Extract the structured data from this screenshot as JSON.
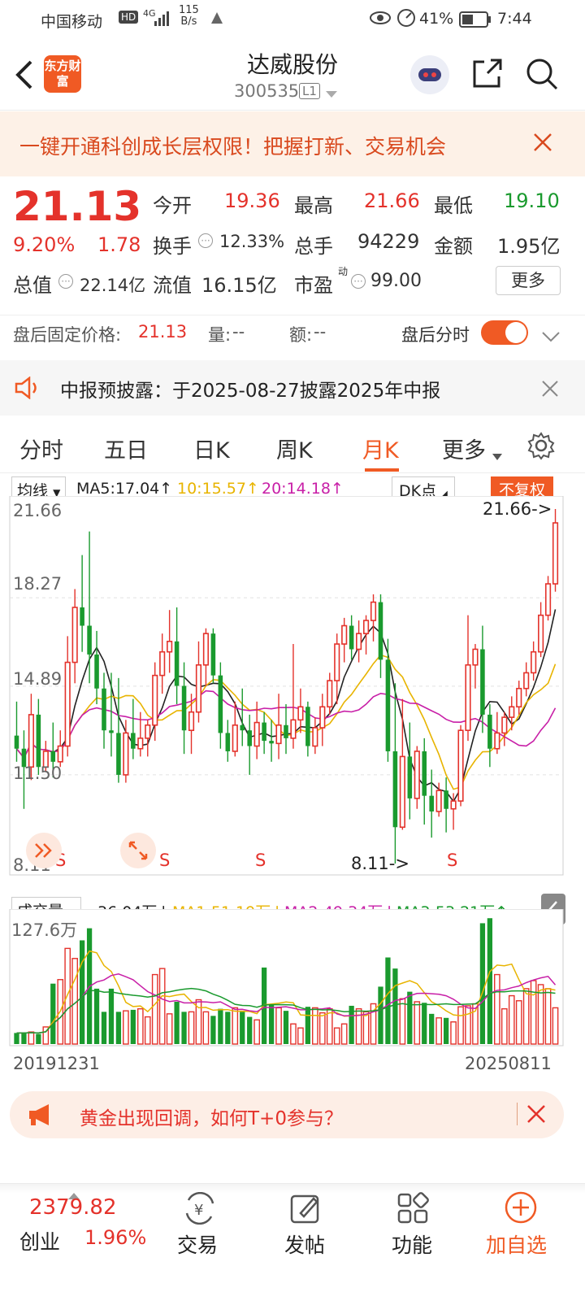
{
  "status": {
    "carrier": "中国移动",
    "hd": "HD",
    "net": "4G",
    "speed_value": "115",
    "speed_unit": "B/s",
    "battery": "41%",
    "time": "7:44"
  },
  "header": {
    "logo": "东方财富",
    "title": "达威股份",
    "code": "300535",
    "level": "L1"
  },
  "banner": {
    "text": "一键开通科创成长层权限！把握打新、交易机会"
  },
  "quote": {
    "price": "21.13",
    "change_pct": "9.20%",
    "change": "1.78",
    "open_label": "今开",
    "open": "19.36",
    "high_label": "最高",
    "high": "21.66",
    "low_label": "最低",
    "low": "19.10",
    "turnover_label": "换手",
    "turnover": "12.33%",
    "volume_label": "总手",
    "volume": "94229",
    "amount_label": "金额",
    "amount": "1.95亿",
    "mktcap_label": "总值",
    "mktcap": "22.14亿",
    "float_label": "流值",
    "float": "16.15亿",
    "pe_label": "市盈",
    "pe_sup": "动",
    "pe": "99.00",
    "more": "更多"
  },
  "after_hours": {
    "fixed_label": "盘后固定价格:",
    "fixed": "21.13",
    "vol_label": "量:",
    "vol": "--",
    "amt_label": "额:",
    "amt": "--",
    "tick_label": "盘后分时"
  },
  "notice": {
    "text": "中报预披露：于2025-08-27披露2025年中报"
  },
  "tabs": [
    "分时",
    "五日",
    "日K",
    "周K",
    "月K",
    "更多"
  ],
  "ma": {
    "select": "均线",
    "ma5": "MA5:17.04↑",
    "ma10": "10:15.57↑",
    "ma20": "20:14.18↑",
    "dk": "DK点",
    "fq": "不复权"
  },
  "price_axis": [
    "21.66",
    "18.27",
    "14.89",
    "11.50",
    "8.11"
  ],
  "markers": {
    "high": "21.66->",
    "low": "8.11->",
    "s": "S"
  },
  "vol": {
    "select": "成交量",
    "value": "36.04万↓",
    "ma1": "MA1:51.19万↓",
    "ma2": "MA2:49.34万↓",
    "ma3": "MA3:53.21万↑",
    "max": "127.6万"
  },
  "dates": {
    "start": "20191231",
    "end": "20250811"
  },
  "ad": {
    "text": "黄金出现回调，如何T+0参与？"
  },
  "index": {
    "value": "2379.82",
    "name": "创业",
    "pct": "1.96%"
  },
  "nav": [
    "交易",
    "发帖",
    "功能",
    "加自选"
  ],
  "colors": {
    "up": "#e4322b",
    "down": "#1a9a2e",
    "accent": "#f05a24"
  },
  "chart_data": {
    "type": "candlestick",
    "period": "月K",
    "ylim": [
      8.11,
      21.66
    ],
    "candles": [
      [
        13.0,
        14.3,
        12.0,
        12.5
      ],
      [
        12.5,
        13.2,
        10.2,
        11.8
      ],
      [
        11.8,
        14.6,
        11.3,
        13.8
      ],
      [
        13.8,
        14.4,
        11.5,
        11.8
      ],
      [
        11.8,
        12.8,
        11.6,
        12.4
      ],
      [
        12.4,
        13.5,
        11.4,
        12.0
      ],
      [
        12.0,
        13.2,
        11.8,
        12.6
      ],
      [
        12.6,
        16.8,
        12.2,
        15.8
      ],
      [
        15.8,
        18.6,
        15.0,
        17.9
      ],
      [
        17.9,
        19.9,
        16.2,
        17.2
      ],
      [
        17.2,
        20.8,
        15.0,
        16.1
      ],
      [
        16.1,
        17.0,
        14.2,
        14.8
      ],
      [
        14.8,
        15.4,
        12.5,
        13.2
      ],
      [
        13.2,
        15.4,
        12.2,
        13.1
      ],
      [
        13.1,
        15.2,
        11.2,
        11.5
      ],
      [
        11.5,
        13.6,
        11.2,
        13.1
      ],
      [
        13.1,
        14.4,
        12.1,
        12.5
      ],
      [
        12.5,
        13.9,
        12.2,
        12.9
      ],
      [
        12.9,
        13.6,
        12.2,
        13.4
      ],
      [
        13.4,
        15.8,
        12.8,
        15.3
      ],
      [
        15.3,
        16.9,
        14.6,
        16.2
      ],
      [
        16.2,
        17.8,
        15.4,
        16.6
      ],
      [
        16.6,
        17.9,
        14.2,
        14.9
      ],
      [
        14.9,
        15.8,
        12.3,
        13.2
      ],
      [
        13.2,
        14.6,
        12.3,
        13.9
      ],
      [
        13.9,
        16.6,
        13.5,
        15.7
      ],
      [
        15.7,
        17.1,
        14.9,
        16.9
      ],
      [
        16.9,
        17.1,
        15.0,
        15.3
      ],
      [
        15.3,
        15.8,
        12.5,
        13.1
      ],
      [
        13.1,
        13.6,
        12.0,
        12.4
      ],
      [
        12.4,
        14.3,
        12.2,
        13.4
      ],
      [
        13.4,
        14.8,
        12.6,
        13.2
      ],
      [
        13.2,
        13.8,
        11.5,
        12.6
      ],
      [
        12.6,
        14.3,
        12.1,
        13.5
      ],
      [
        13.5,
        13.9,
        12.3,
        12.8
      ],
      [
        12.8,
        13.6,
        12.0,
        12.7
      ],
      [
        12.7,
        14.6,
        12.1,
        13.4
      ],
      [
        13.4,
        14.2,
        12.3,
        12.9
      ],
      [
        12.9,
        16.5,
        12.5,
        13.6
      ],
      [
        13.6,
        14.8,
        13.1,
        14.1
      ],
      [
        14.1,
        14.3,
        12.2,
        12.6
      ],
      [
        12.6,
        13.7,
        12.3,
        13.3
      ],
      [
        13.3,
        14.6,
        12.6,
        14.1
      ],
      [
        14.1,
        15.4,
        13.8,
        15.1
      ],
      [
        15.1,
        16.9,
        14.2,
        16.5
      ],
      [
        16.5,
        17.5,
        15.8,
        17.2
      ],
      [
        17.2,
        17.6,
        15.9,
        16.3
      ],
      [
        16.3,
        17.4,
        15.8,
        16.9
      ],
      [
        16.9,
        17.6,
        16.1,
        17.4
      ],
      [
        17.4,
        18.4,
        16.6,
        18.1
      ],
      [
        18.1,
        18.4,
        15.2,
        15.9
      ],
      [
        15.9,
        16.7,
        12.0,
        12.4
      ],
      [
        12.4,
        15.0,
        8.11,
        9.5
      ],
      [
        9.5,
        14.4,
        9.4,
        12.2
      ],
      [
        12.2,
        13.5,
        9.8,
        10.6
      ],
      [
        10.6,
        12.6,
        10.2,
        12.4
      ],
      [
        12.4,
        12.9,
        9.6,
        10.7
      ],
      [
        10.7,
        11.7,
        9.1,
        10.1
      ],
      [
        10.1,
        11.2,
        9.9,
        10.9
      ],
      [
        10.9,
        11.4,
        9.3,
        10.2
      ],
      [
        10.2,
        10.8,
        9.4,
        10.5
      ],
      [
        10.5,
        13.4,
        10.3,
        13.2
      ],
      [
        13.2,
        17.6,
        12.8,
        15.7
      ],
      [
        15.7,
        16.5,
        14.8,
        16.3
      ],
      [
        16.3,
        17.2,
        13.1,
        13.8
      ],
      [
        13.8,
        14.2,
        11.8,
        12.5
      ],
      [
        12.5,
        13.9,
        12.3,
        13.1
      ],
      [
        13.1,
        13.9,
        12.6,
        13.7
      ],
      [
        13.7,
        14.5,
        13.2,
        14.1
      ],
      [
        14.1,
        15.1,
        13.8,
        14.8
      ],
      [
        14.8,
        15.8,
        14.5,
        15.4
      ],
      [
        15.4,
        16.6,
        15.1,
        16.2
      ],
      [
        16.2,
        18.1,
        16.0,
        17.6
      ],
      [
        17.6,
        19.1,
        17.4,
        18.8
      ],
      [
        18.8,
        21.66,
        18.5,
        21.13
      ]
    ],
    "volumes": [
      11,
      11,
      12,
      10,
      17,
      60,
      64,
      95,
      85,
      103,
      115,
      55,
      32,
      55,
      32,
      33,
      34,
      35,
      27,
      69,
      75,
      30,
      42,
      32,
      32,
      44,
      32,
      28,
      35,
      32,
      36,
      32,
      27,
      24,
      76,
      40,
      36,
      33,
      20,
      16,
      37,
      36,
      31,
      35,
      16,
      20,
      38,
      35,
      32,
      40,
      57,
      86,
      75,
      45,
      52,
      42,
      41,
      30,
      26,
      26,
      22,
      37,
      38,
      40,
      120,
      125,
      69,
      35,
      48,
      43,
      55,
      63,
      59,
      55,
      36
    ]
  }
}
